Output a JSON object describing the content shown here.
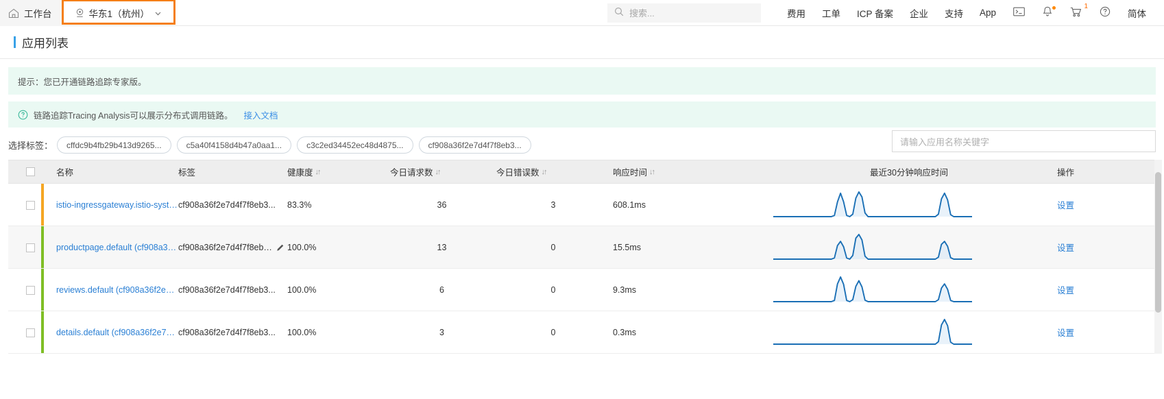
{
  "topnav": {
    "home": {
      "label": "工作台",
      "icon": "home-icon"
    },
    "region": {
      "label": "华东1（杭州）",
      "icon": "location-pin-icon",
      "caret": "chevron-down-icon",
      "highlight_color": "#f57f17"
    },
    "search": {
      "placeholder": "搜索...",
      "icon": "search-icon"
    },
    "items": [
      {
        "label": "费用",
        "type": "text"
      },
      {
        "label": "工单",
        "type": "text"
      },
      {
        "label": "ICP 备案",
        "type": "text"
      },
      {
        "label": "企业",
        "type": "text"
      },
      {
        "label": "支持",
        "type": "text"
      },
      {
        "label": "App",
        "type": "text"
      },
      {
        "label": "",
        "type": "icon",
        "icon": "terminal-icon"
      },
      {
        "label": "",
        "type": "icon",
        "icon": "bell-icon",
        "badge_dot": true
      },
      {
        "label": "",
        "type": "icon",
        "icon": "cart-icon",
        "badge": "1"
      },
      {
        "label": "",
        "type": "icon",
        "icon": "help-circle-icon"
      },
      {
        "label": "简体",
        "type": "text"
      }
    ]
  },
  "page": {
    "title": "应用列表",
    "title_bar_color": "#38a1e7"
  },
  "alerts": [
    {
      "text": "提示：您已开通链路追踪专家版。",
      "icon": null,
      "link": null
    },
    {
      "text": "链路追踪Tracing Analysis可以展示分布式调用链路。",
      "icon": "question-circle-icon",
      "link": "接入文档"
    }
  ],
  "filter": {
    "label": "选择标签：",
    "tags": [
      "cffdc9b4fb29b413d9265...",
      "c5a40f4158d4b47a0aa1...",
      "c3c2ed34452ec48d4875...",
      "cf908a36f2e7d4f7f8eb3..."
    ],
    "keyword_placeholder": "请输入应用名称关键字"
  },
  "table": {
    "headers": [
      {
        "label": "",
        "sortable": false
      },
      {
        "label": "名称",
        "sortable": false
      },
      {
        "label": "标签",
        "sortable": false
      },
      {
        "label": "健康度",
        "sortable": true
      },
      {
        "label": "今日请求数",
        "sortable": true
      },
      {
        "label": "今日错误数",
        "sortable": true
      },
      {
        "label": "响应时间",
        "sortable": true
      },
      {
        "label": "最近30分钟响应时间",
        "sortable": false
      },
      {
        "label": "操作",
        "sortable": false
      }
    ],
    "sort_glyph": "↓↑",
    "action_label": "设置",
    "rows": [
      {
        "status_color": "#f5a623",
        "name": "istio-ingressgateway.istio-system...",
        "tag": "cf908a36f2e7d4f7f8eb3...",
        "has_edit": false,
        "health": "83.3%",
        "requests": "36",
        "errors": "3",
        "response_time": "608.1ms",
        "action": "设置",
        "sparkline": [
          0,
          0,
          0,
          0,
          0,
          0,
          0,
          0,
          0,
          0,
          0,
          0,
          0,
          0,
          0,
          0,
          0,
          0,
          0,
          0,
          0.05,
          0.6,
          0.95,
          0.6,
          0.05,
          0,
          0.1,
          0.75,
          1.0,
          0.8,
          0.15,
          0,
          0,
          0,
          0,
          0,
          0,
          0,
          0,
          0,
          0,
          0,
          0,
          0,
          0,
          0,
          0,
          0,
          0,
          0,
          0,
          0,
          0,
          0,
          0.1,
          0.72,
          0.95,
          0.68,
          0.08,
          0,
          0,
          0,
          0,
          0,
          0,
          0
        ]
      },
      {
        "status_color": "#7fbe25",
        "name": "productpage.default (cf908a36f2...",
        "tag": "cf908a36f2e7d4f7f8eb3...",
        "has_edit": true,
        "health": "100.0%",
        "requests": "13",
        "errors": "0",
        "response_time": "15.5ms",
        "action": "设置",
        "sparkline": [
          0,
          0,
          0,
          0,
          0,
          0,
          0,
          0,
          0,
          0,
          0,
          0,
          0,
          0,
          0,
          0,
          0,
          0,
          0,
          0,
          0.05,
          0.55,
          0.72,
          0.5,
          0.05,
          0,
          0.15,
          0.85,
          1.0,
          0.78,
          0.12,
          0,
          0,
          0,
          0,
          0,
          0,
          0,
          0,
          0,
          0,
          0,
          0,
          0,
          0,
          0,
          0,
          0,
          0,
          0,
          0,
          0,
          0,
          0,
          0.08,
          0.6,
          0.72,
          0.52,
          0.06,
          0,
          0,
          0,
          0,
          0,
          0,
          0
        ]
      },
      {
        "status_color": "#7fbe25",
        "name": "reviews.default (cf908a36f2e7d4...",
        "tag": "cf908a36f2e7d4f7f8eb3...",
        "has_edit": false,
        "health": "100.0%",
        "requests": "6",
        "errors": "0",
        "response_time": "9.3ms",
        "action": "设置",
        "sparkline": [
          0,
          0,
          0,
          0,
          0,
          0,
          0,
          0,
          0,
          0,
          0,
          0,
          0,
          0,
          0,
          0,
          0,
          0,
          0,
          0,
          0.05,
          0.72,
          1.0,
          0.7,
          0.05,
          0,
          0.08,
          0.62,
          0.85,
          0.6,
          0.06,
          0,
          0,
          0,
          0,
          0,
          0,
          0,
          0,
          0,
          0,
          0,
          0,
          0,
          0,
          0,
          0,
          0,
          0,
          0,
          0,
          0,
          0,
          0,
          0.08,
          0.55,
          0.72,
          0.5,
          0.05,
          0,
          0,
          0,
          0,
          0,
          0,
          0
        ]
      },
      {
        "status_color": "#7fbe25",
        "name": "details.default (cf908a36f2e7d4f...",
        "tag": "cf908a36f2e7d4f7f8eb3...",
        "has_edit": false,
        "health": "100.0%",
        "requests": "3",
        "errors": "0",
        "response_time": "0.3ms",
        "action": "设置",
        "sparkline": [
          0,
          0,
          0,
          0,
          0,
          0,
          0,
          0,
          0,
          0,
          0,
          0,
          0,
          0,
          0,
          0,
          0,
          0,
          0,
          0,
          0,
          0,
          0,
          0,
          0,
          0,
          0,
          0,
          0,
          0,
          0,
          0,
          0,
          0,
          0,
          0,
          0,
          0,
          0,
          0,
          0,
          0,
          0,
          0,
          0,
          0,
          0,
          0,
          0,
          0,
          0,
          0,
          0,
          0,
          0.1,
          0.78,
          1.0,
          0.75,
          0.08,
          0,
          0,
          0,
          0,
          0,
          0,
          0
        ]
      }
    ]
  },
  "chart_data": {
    "type": "line",
    "title": "最近30分钟响应时间",
    "series": [
      {
        "name": "istio-ingressgateway.istio-system",
        "peak_ms": 608.1
      },
      {
        "name": "productpage.default",
        "peak_ms": 15.5
      },
      {
        "name": "reviews.default",
        "peak_ms": 9.3
      },
      {
        "name": "details.default",
        "peak_ms": 0.3
      }
    ],
    "line_color": "#1a6fb5",
    "xlabel": "",
    "ylabel": ""
  }
}
